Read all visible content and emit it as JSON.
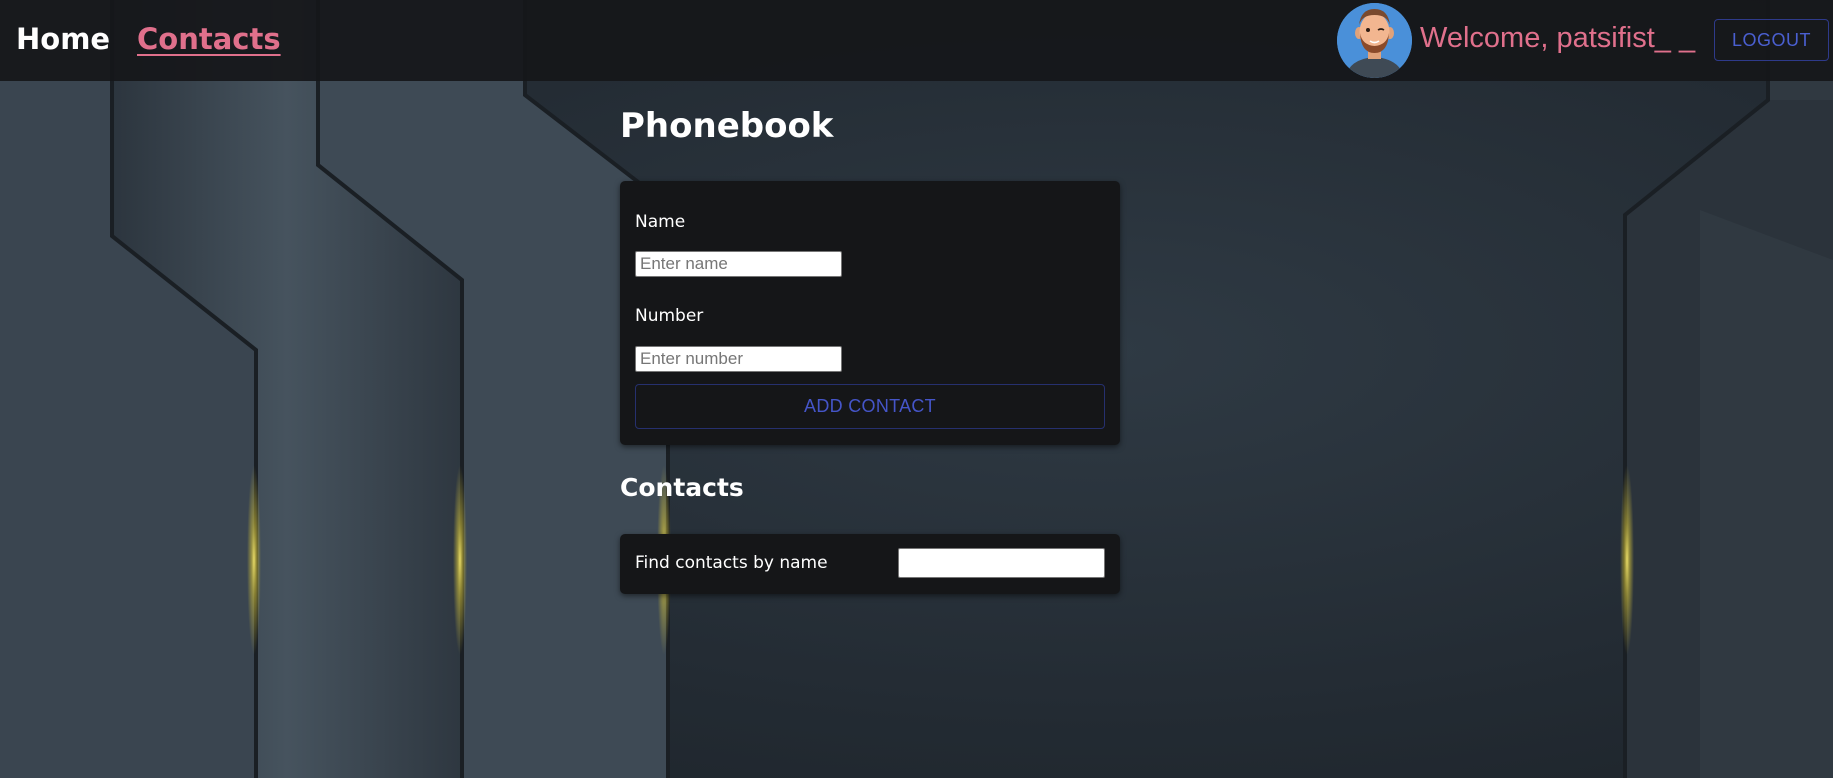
{
  "nav": {
    "home_label": "Home",
    "contacts_label": "Contacts",
    "welcome_text": "Welcome, patsifist_ _",
    "logout_label": "LOGOUT",
    "avatar_icon": "user-avatar-icon"
  },
  "main": {
    "title": "Phonebook",
    "form": {
      "name_label": "Name",
      "name_placeholder": "Enter name",
      "name_value": "",
      "number_label": "Number",
      "number_placeholder": "Enter number",
      "number_value": "",
      "add_button_label": "ADD CONTACT"
    },
    "contacts_title": "Contacts",
    "filter": {
      "label": "Find contacts by name",
      "value": ""
    }
  },
  "colors": {
    "accent_pink": "#e0708c",
    "button_blue": "#4555c8",
    "card_background": "#151618",
    "navbar_background": "#16171a"
  }
}
